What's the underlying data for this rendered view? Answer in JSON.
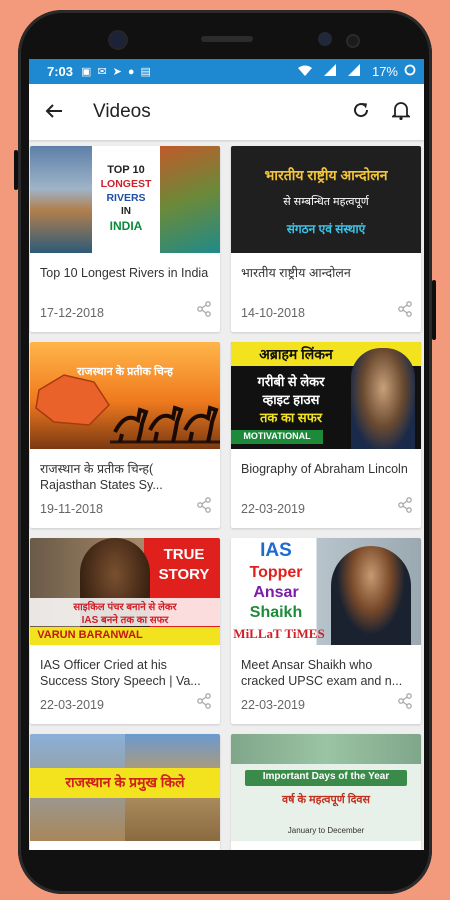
{
  "status_bar": {
    "time": "7:03",
    "battery": "17%"
  },
  "app_bar": {
    "title": "Videos",
    "back_icon": "arrow-left-icon",
    "refresh_icon": "refresh-icon",
    "bell_icon": "bell-icon"
  },
  "videos": [
    {
      "title": "Top 10 Longest Rivers in India",
      "date": "17-12-2018",
      "thumb_text": [
        "TOP 10",
        "LONGEST",
        "RIVERS",
        "IN",
        "INDIA"
      ]
    },
    {
      "title": "भारतीय राष्ट्रीय आन्दोलन",
      "date": "14-10-2018",
      "thumb_text": [
        "भारतीय राष्ट्रीय आन्दोलन",
        "से सम्बन्धित महत्वपूर्ण",
        "संगठन एवं संस्थाएं"
      ]
    },
    {
      "title": "राजस्थान के प्रतीक चिन्ह( Rajasthan States Sy...",
      "date": "19-11-2018",
      "thumb_text": [
        "राजस्थान के प्रतीक चिन्ह"
      ]
    },
    {
      "title": "Biography of Abraham Lincoln",
      "date": "22-03-2019",
      "thumb_text": [
        "अब्राहम लिंकन",
        "गरीबी से लेकर",
        "व्हाइट हाउस",
        "तक का सफर",
        "MOTIVATIONAL"
      ]
    },
    {
      "title": "IAS Officer Cried at his Success Story Speech | Va...",
      "date": "22-03-2019",
      "thumb_text": [
        "TRUE",
        "STORY",
        "साइकिल पंचर बनाने से लेकर",
        "IAS बनने तक का सफर",
        "VARUN BARANWAL"
      ]
    },
    {
      "title": "Meet Ansar Shaikh who cracked UPSC exam and n...",
      "date": "22-03-2019",
      "thumb_text": [
        "IAS",
        "Topper",
        "Ansar",
        "Shaikh",
        "MiLLaT TiMES"
      ]
    },
    {
      "title": "",
      "date": "",
      "thumb_text": [
        "राजस्थान के प्रमुख किले"
      ]
    },
    {
      "title": "",
      "date": "",
      "thumb_text": [
        "Important Days of the Year",
        "वर्ष के महत्वपूर्ण दिवस",
        "January to December"
      ]
    }
  ]
}
